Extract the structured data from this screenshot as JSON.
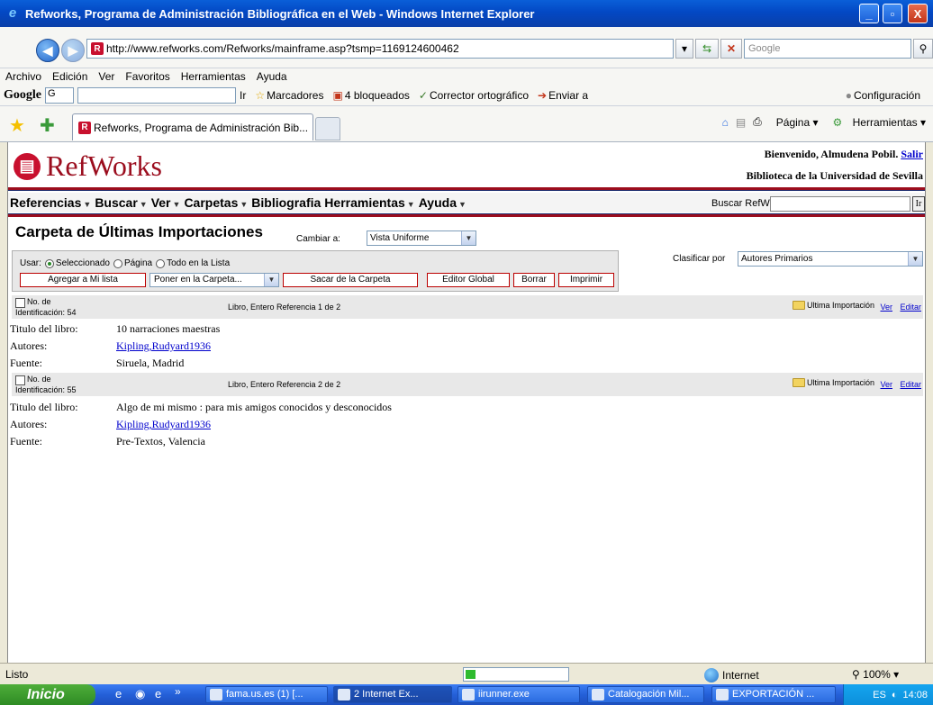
{
  "window": {
    "title": "Refworks, Programa de Administración Bibliográfica en el Web - Windows Internet Explorer",
    "minimize": "_",
    "maximize": "▫",
    "close": "X"
  },
  "address": {
    "url": "http://www.refworks.com/Refworks/mainframe.asp?tsmp=1169124600462",
    "search_placeholder": "Google"
  },
  "menu": [
    "Archivo",
    "Edición",
    "Ver",
    "Favoritos",
    "Herramientas",
    "Ayuda"
  ],
  "google_toolbar": {
    "logo": "Google",
    "engine": "G",
    "go": "Ir",
    "bookmarks": "Marcadores",
    "blocked": "4 bloqueados",
    "spellcheck": "Corrector ortográfico",
    "send": "Enviar a",
    "settings": "Configuración"
  },
  "tabs": [
    {
      "label": "Refworks, Programa de Administración Bib..."
    }
  ],
  "commandbar": {
    "page": "Página",
    "tools": "Herramientas"
  },
  "refworks": {
    "logo": "RefWorks",
    "welcome": "Bienvenido, Almudena Pobil.",
    "logout": "Salir",
    "library": "Biblioteca de la Universidad de Sevilla",
    "nav": [
      "Referencias",
      "Buscar",
      "Ver",
      "Carpetas",
      "Bibliografia",
      "Herramientas",
      "Ayuda"
    ],
    "search_label": "Buscar RefWorks",
    "search_go": "Ir"
  },
  "folder": {
    "title": "Carpeta de Últimas Importaciones",
    "change_label": "Cambiar a:",
    "view": "Vista Uniforme",
    "use_label": "Usar:",
    "use_options": [
      "Seleccionado",
      "Página",
      "Todo en la Lista"
    ],
    "buttons": {
      "add": "Agregar a Mi lista",
      "put": "Poner en la Carpeta...",
      "remove": "Sacar de la Carpeta",
      "global": "Editor Global",
      "delete": "Borrar",
      "print": "Imprimir"
    },
    "sort_label": "Clasificar  por",
    "sort_value": "Autores Primarios"
  },
  "references": [
    {
      "id_label": "No. de",
      "id": "Identificación: 54",
      "type": "Libro, Entero Referencia 1 de 2",
      "folder": "Ultima Importación",
      "view": "Ver",
      "edit": "Editar",
      "title_label": "Titulo del libro:",
      "title": "10 narraciones maestras",
      "authors_label": "Autores:",
      "authors": "Kipling,Rudyard1936",
      "source_label": "Fuente:",
      "source": "Siruela, Madrid"
    },
    {
      "id_label": "No. de",
      "id": "Identificación: 55",
      "type": "Libro, Entero Referencia 2 de 2",
      "folder": "Ultima Importación",
      "view": "Ver",
      "edit": "Editar",
      "title_label": "Titulo del libro:",
      "title": "Algo de mi mismo : para mis amigos conocidos y desconocidos",
      "authors_label": "Autores:",
      "authors": "Kipling,Rudyard1936",
      "source_label": "Fuente:",
      "source": "Pre-Textos, Valencia"
    }
  ],
  "status": {
    "text": "Listo",
    "zone": "Internet",
    "zoom": "100%",
    "progress": 0.1
  },
  "taskbar": {
    "start": "Inicio",
    "items": [
      "fama.us.es (1) [...",
      "2 Internet Ex...",
      "iirunner.exe",
      "Catalogación Mil...",
      "EXPORTACIÓN ..."
    ],
    "lang": "ES",
    "clock": "14:08"
  }
}
